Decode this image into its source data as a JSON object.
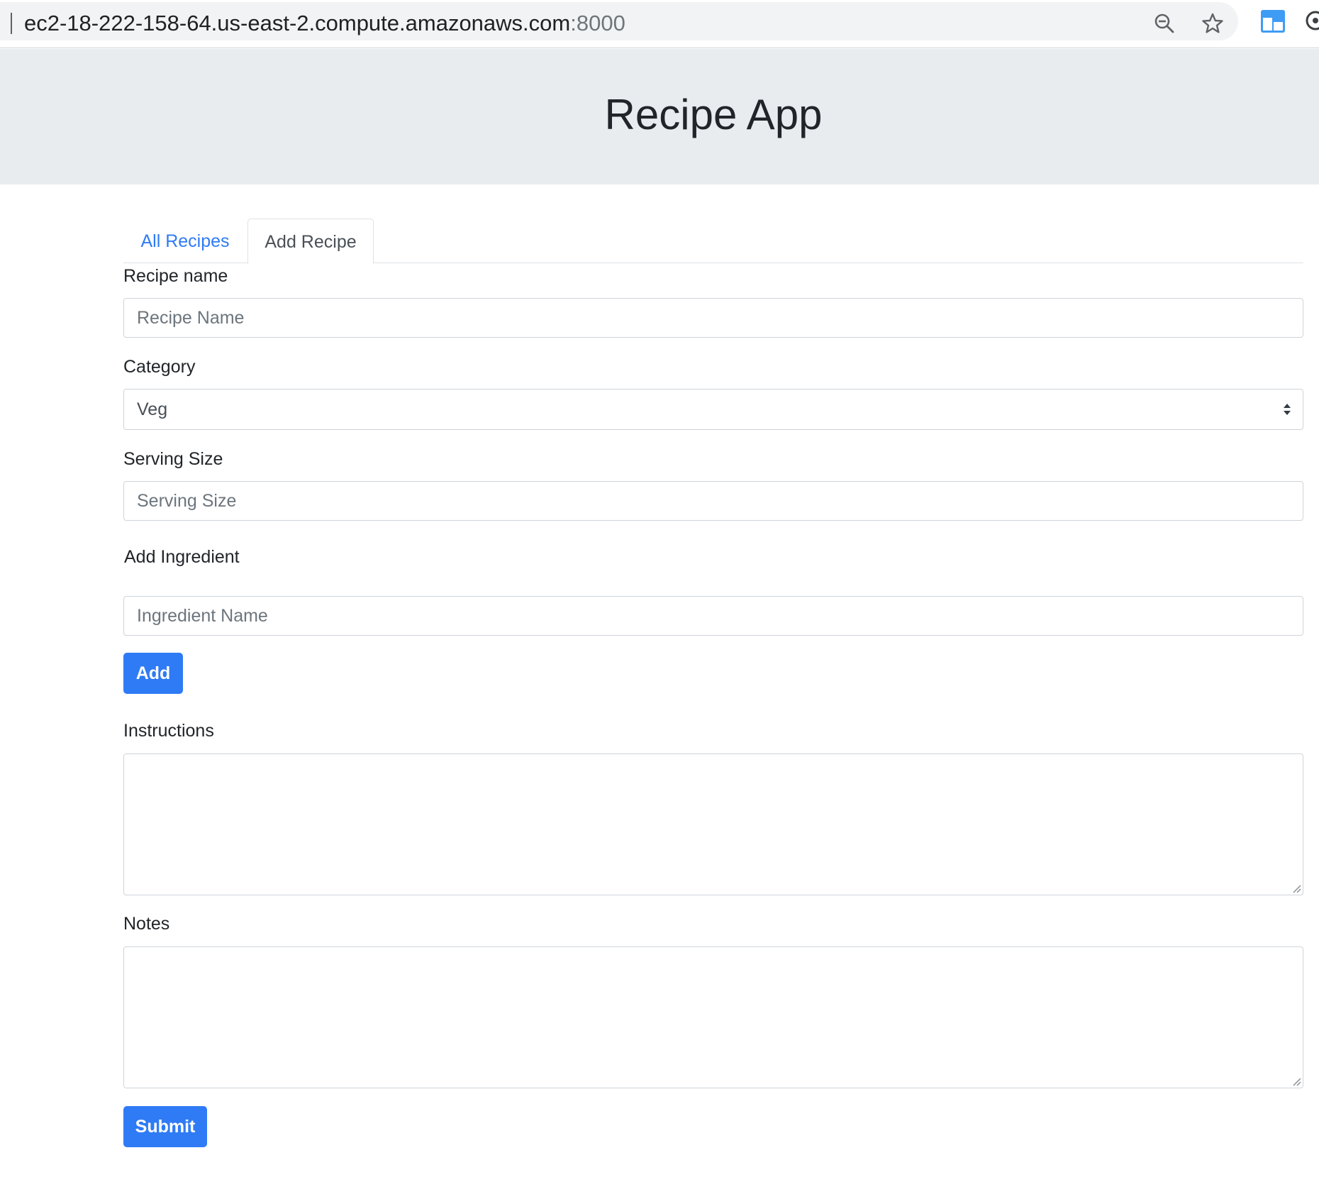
{
  "browser": {
    "url_host": "ec2-18-222-158-64.us-east-2.compute.amazonaws.com",
    "url_port": ":8000",
    "icons": [
      "zoom-out-icon",
      "bookmark-star-icon",
      "extension-icon",
      "profile-icon"
    ]
  },
  "header": {
    "title": "Recipe App"
  },
  "tabs": [
    {
      "label": "All Recipes",
      "active": false
    },
    {
      "label": "Add Recipe",
      "active": true
    }
  ],
  "form": {
    "recipe_name": {
      "label": "Recipe name",
      "placeholder": "Recipe Name",
      "value": ""
    },
    "category": {
      "label": "Category",
      "selected": "Veg"
    },
    "serving_size": {
      "label": "Serving Size",
      "placeholder": "Serving Size",
      "value": ""
    },
    "ingredient": {
      "label": "Add Ingredient",
      "placeholder": "Ingredient Name",
      "value": "",
      "add_button": "Add"
    },
    "instructions": {
      "label": "Instructions",
      "value": ""
    },
    "notes": {
      "label": "Notes",
      "value": ""
    },
    "submit_button": "Submit"
  },
  "colors": {
    "primary": "#2f7bf5",
    "jumbotron_bg": "#e9ecef",
    "border": "#ced4da"
  }
}
